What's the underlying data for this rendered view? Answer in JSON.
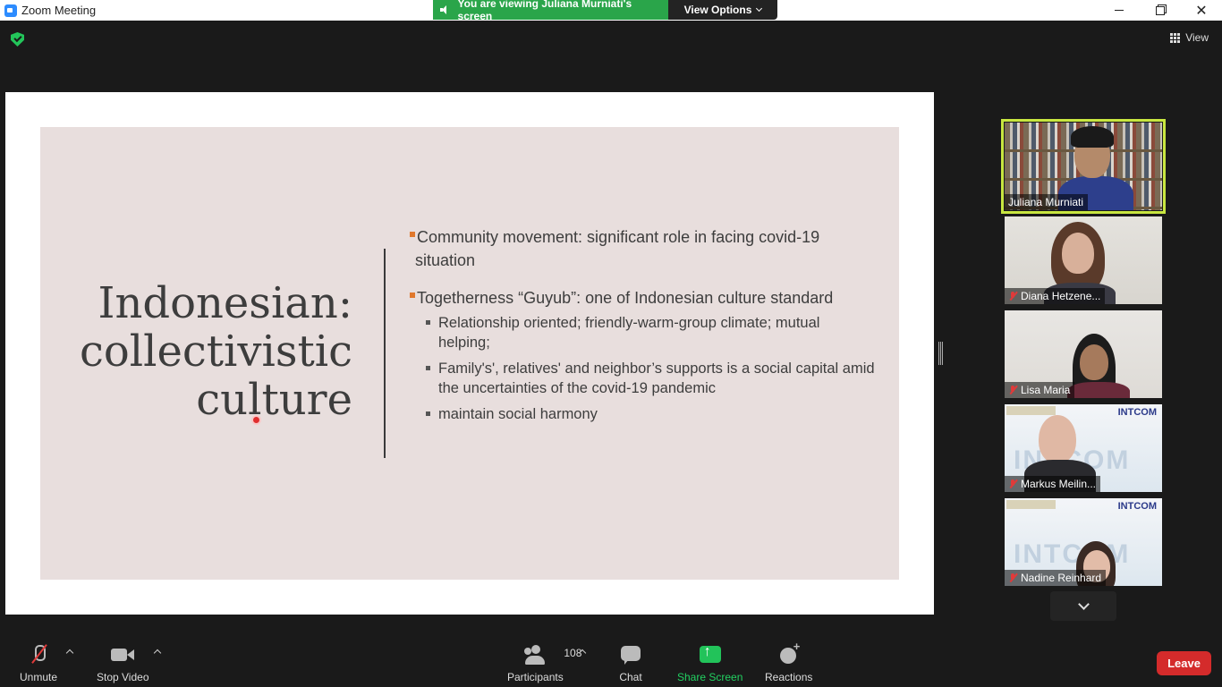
{
  "window": {
    "title": "Zoom Meeting"
  },
  "banner": {
    "viewing": "You are viewing Juliana Murniati's screen",
    "options": "View Options"
  },
  "topbar": {
    "view_label": "View"
  },
  "slide": {
    "title_lines": [
      "Indonesian:",
      "collectivistic",
      "culture"
    ],
    "bullets": [
      {
        "text": "Community movement: significant role in facing covid-19 situation",
        "sub": []
      },
      {
        "text": "Togetherness “Guyub”: one of Indonesian culture standard",
        "sub": [
          "Relationship oriented; friendly-warm-group climate; mutual helping;",
          "Family's', relatives' and neighbor’s supports is a social capital amid the uncertainties of the covid-19 pandemic",
          "maintain social harmony"
        ]
      }
    ]
  },
  "participants": [
    {
      "name": "Juliana Murniati",
      "muted": false,
      "active": true
    },
    {
      "name": "Diana Hetzene...",
      "muted": true,
      "active": false
    },
    {
      "name": "Lisa Maria",
      "muted": true,
      "active": false
    },
    {
      "name": "Markus Meilin...",
      "muted": true,
      "active": false
    },
    {
      "name": "Nadine Reinhard",
      "muted": true,
      "active": false
    }
  ],
  "tile_branding": {
    "logo": "INTCOM",
    "watermark": "INTCOM"
  },
  "toolbar": {
    "unmute": "Unmute",
    "stop_video": "Stop Video",
    "participants": "Participants",
    "participant_count": "108",
    "chat": "Chat",
    "share_screen": "Share Screen",
    "reactions": "Reactions",
    "leave": "Leave"
  },
  "colors": {
    "share_green": "#22c35a",
    "leave_red": "#d42b2b",
    "active_speaker": "#c8e640",
    "bullet_orange": "#e0782d"
  }
}
